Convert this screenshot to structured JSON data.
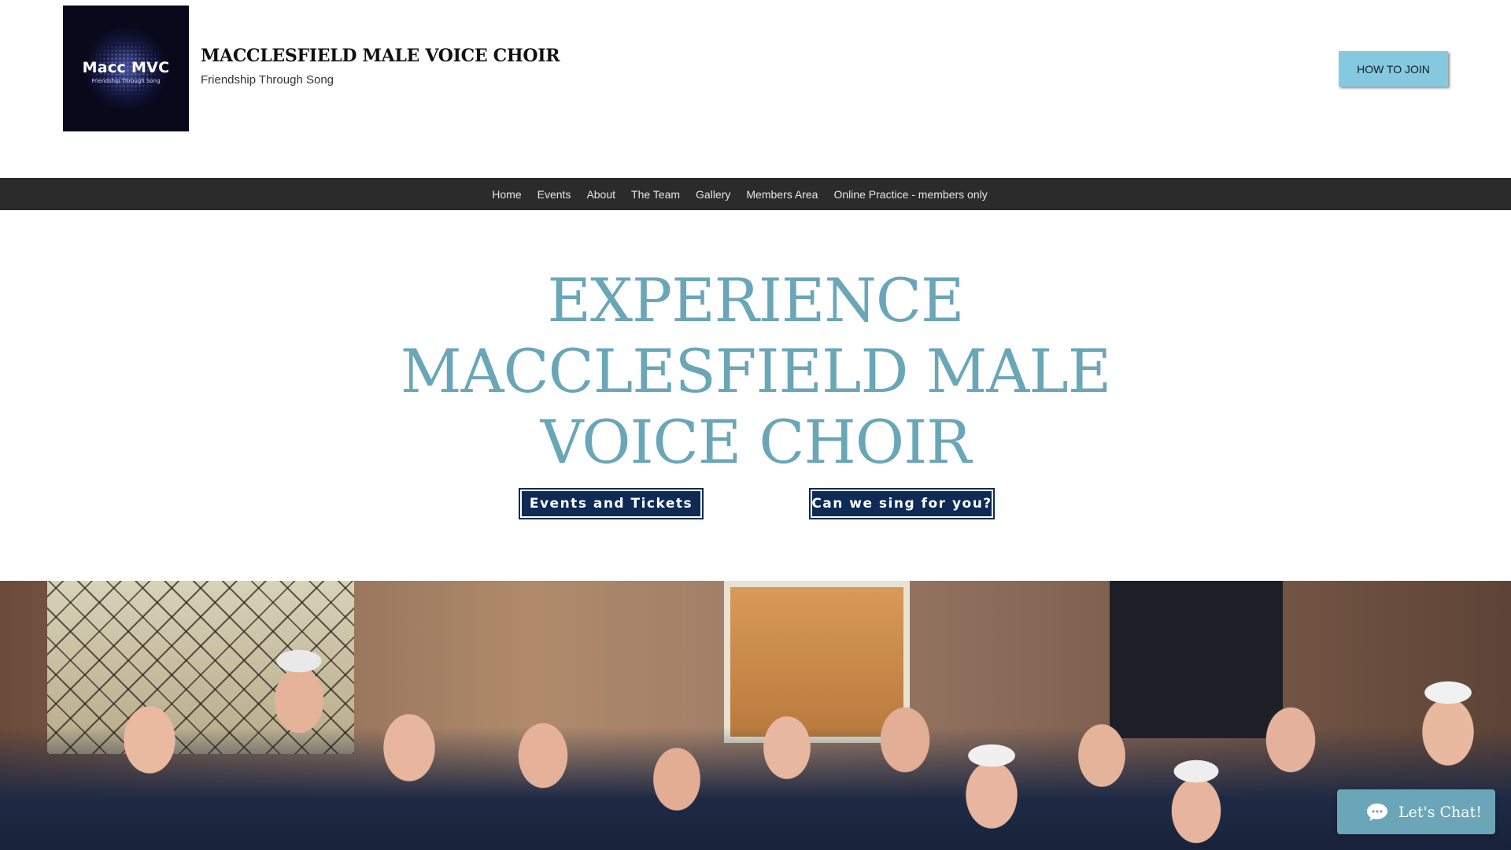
{
  "header": {
    "logo": {
      "title": "Macc MVC",
      "subtitle": "Friendship Through Song"
    },
    "site_title": "MACCLESFIELD MALE VOICE CHOIR",
    "tagline": "Friendship Through Song",
    "join_label": "HOW TO JOIN"
  },
  "nav": {
    "items": [
      {
        "label": "Home"
      },
      {
        "label": "Events"
      },
      {
        "label": "About"
      },
      {
        "label": "The Team"
      },
      {
        "label": "Gallery"
      },
      {
        "label": "Members Area"
      },
      {
        "label": "Online Practice - members only"
      }
    ]
  },
  "hero": {
    "title_lines": [
      "EXPERIENCE",
      "MACCLESFIELD MALE",
      "VOICE CHOIR"
    ],
    "events_button": "Events and Tickets",
    "sing_button": "Can we sing for you?"
  },
  "chat": {
    "label": "Let's Chat!",
    "icon": "chat-bubble-icon"
  },
  "colors": {
    "accent": "#6aa6b8",
    "join_button": "#84c9e0",
    "nav_bg": "#2b2b2b",
    "cta_bg": "#0e2a55"
  }
}
